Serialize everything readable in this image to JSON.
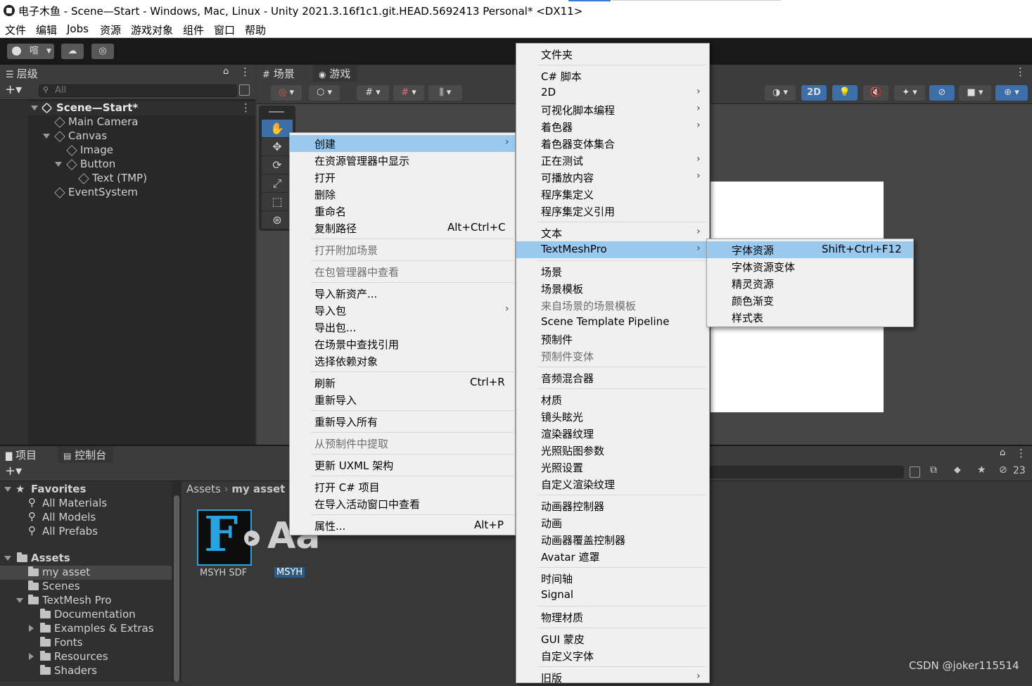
{
  "window": {
    "title": "电子木鱼 - Scene—Start - Windows, Mac, Linux - Unity 2021.3.16f1c1.git.HEAD.5692413 Personal* <DX11>"
  },
  "menubar": [
    "文件",
    "编辑",
    "Jobs",
    "资源",
    "游戏对象",
    "组件",
    "窗口",
    "帮助"
  ],
  "toolbar": {
    "account_label": "喧"
  },
  "hierarchy": {
    "tab": "层级",
    "search_placeholder": "All",
    "scene": "Scene—Start*",
    "items": [
      "Main Camera",
      "Canvas",
      "Image",
      "Button",
      "Text (TMP)",
      "EventSystem"
    ]
  },
  "scene_view": {
    "tab_scene": "场景",
    "tab_game": "游戏",
    "mode_2d": "2D"
  },
  "project": {
    "tab_project": "项目",
    "tab_console": "控制台",
    "favorites": "Favorites",
    "fav_items": [
      "All Materials",
      "All Models",
      "All Prefabs"
    ],
    "assets": "Assets",
    "asset_items": [
      "my asset",
      "Scenes",
      "TextMesh Pro",
      "Documentation",
      "Examples & Extras",
      "Fonts",
      "Resources",
      "Shaders"
    ],
    "breadcrumb_root": "Assets",
    "breadcrumb_leaf": "my asset",
    "files": [
      "MSYH SDF",
      "MSYH"
    ],
    "hidden_count": "23"
  },
  "context_menu": {
    "items": [
      {
        "label": "创建",
        "shortcut": "",
        "arrow": "›"
      },
      {
        "label": "在资源管理器中显示",
        "shortcut": ""
      },
      {
        "label": "打开",
        "shortcut": ""
      },
      {
        "label": "删除",
        "shortcut": ""
      },
      {
        "label": "重命名",
        "shortcut": ""
      },
      {
        "label": "复制路径",
        "shortcut": "Alt+Ctrl+C"
      },
      {
        "label": "打开附加场景",
        "shortcut": ""
      },
      {
        "label": "在包管理器中查看",
        "shortcut": ""
      },
      {
        "label": "导入新资产...",
        "shortcut": ""
      },
      {
        "label": "导入包",
        "shortcut": "",
        "arrow": "›"
      },
      {
        "label": "导出包...",
        "shortcut": ""
      },
      {
        "label": "在场景中查找引用",
        "shortcut": ""
      },
      {
        "label": "选择依赖对象",
        "shortcut": ""
      },
      {
        "label": "刷新",
        "shortcut": "Ctrl+R"
      },
      {
        "label": "重新导入",
        "shortcut": ""
      },
      {
        "label": "重新导入所有",
        "shortcut": ""
      },
      {
        "label": "从预制件中提取",
        "shortcut": ""
      },
      {
        "label": "更新 UXML 架构",
        "shortcut": ""
      },
      {
        "label": "打开 C# 项目",
        "shortcut": ""
      },
      {
        "label": "在导入活动窗口中查看",
        "shortcut": ""
      },
      {
        "label": "属性...",
        "shortcut": "Alt+P"
      }
    ]
  },
  "create_menu": {
    "items": [
      {
        "label": "文件夹"
      },
      {
        "label": "C# 脚本"
      },
      {
        "label": "2D",
        "arrow": "›"
      },
      {
        "label": "可视化脚本编程",
        "arrow": "›"
      },
      {
        "label": "着色器",
        "arrow": "›"
      },
      {
        "label": "着色器变体集合"
      },
      {
        "label": "正在测试",
        "arrow": "›"
      },
      {
        "label": "可播放内容",
        "arrow": "›"
      },
      {
        "label": "程序集定义"
      },
      {
        "label": "程序集定义引用"
      },
      {
        "label": "文本",
        "arrow": "›"
      },
      {
        "label": "TextMeshPro",
        "arrow": "›"
      },
      {
        "label": "场景"
      },
      {
        "label": "场景模板"
      },
      {
        "label": "来自场景的场景模板"
      },
      {
        "label": "Scene Template Pipeline"
      },
      {
        "label": "预制件"
      },
      {
        "label": "预制件变体"
      },
      {
        "label": "音频混合器"
      },
      {
        "label": "材质"
      },
      {
        "label": "镜头眩光"
      },
      {
        "label": "渲染器纹理"
      },
      {
        "label": "光照贴图参数"
      },
      {
        "label": "光照设置"
      },
      {
        "label": "自定义渲染纹理"
      },
      {
        "label": "动画器控制器"
      },
      {
        "label": "动画"
      },
      {
        "label": "动画器覆盖控制器"
      },
      {
        "label": "Avatar 遮罩"
      },
      {
        "label": "时间轴"
      },
      {
        "label": "Signal"
      },
      {
        "label": "物理材质"
      },
      {
        "label": "GUI 蒙皮"
      },
      {
        "label": "自定义字体"
      },
      {
        "label": "旧版",
        "arrow": "›"
      }
    ]
  },
  "tmp_menu": {
    "items": [
      {
        "label": "字体资源",
        "shortcut": "Shift+Ctrl+F12"
      },
      {
        "label": "字体资源变体",
        "shortcut": ""
      },
      {
        "label": "精灵资源",
        "shortcut": ""
      },
      {
        "label": "颜色渐变",
        "shortcut": ""
      },
      {
        "label": "样式表",
        "shortcut": ""
      }
    ]
  },
  "watermark": "CSDN @joker115514"
}
